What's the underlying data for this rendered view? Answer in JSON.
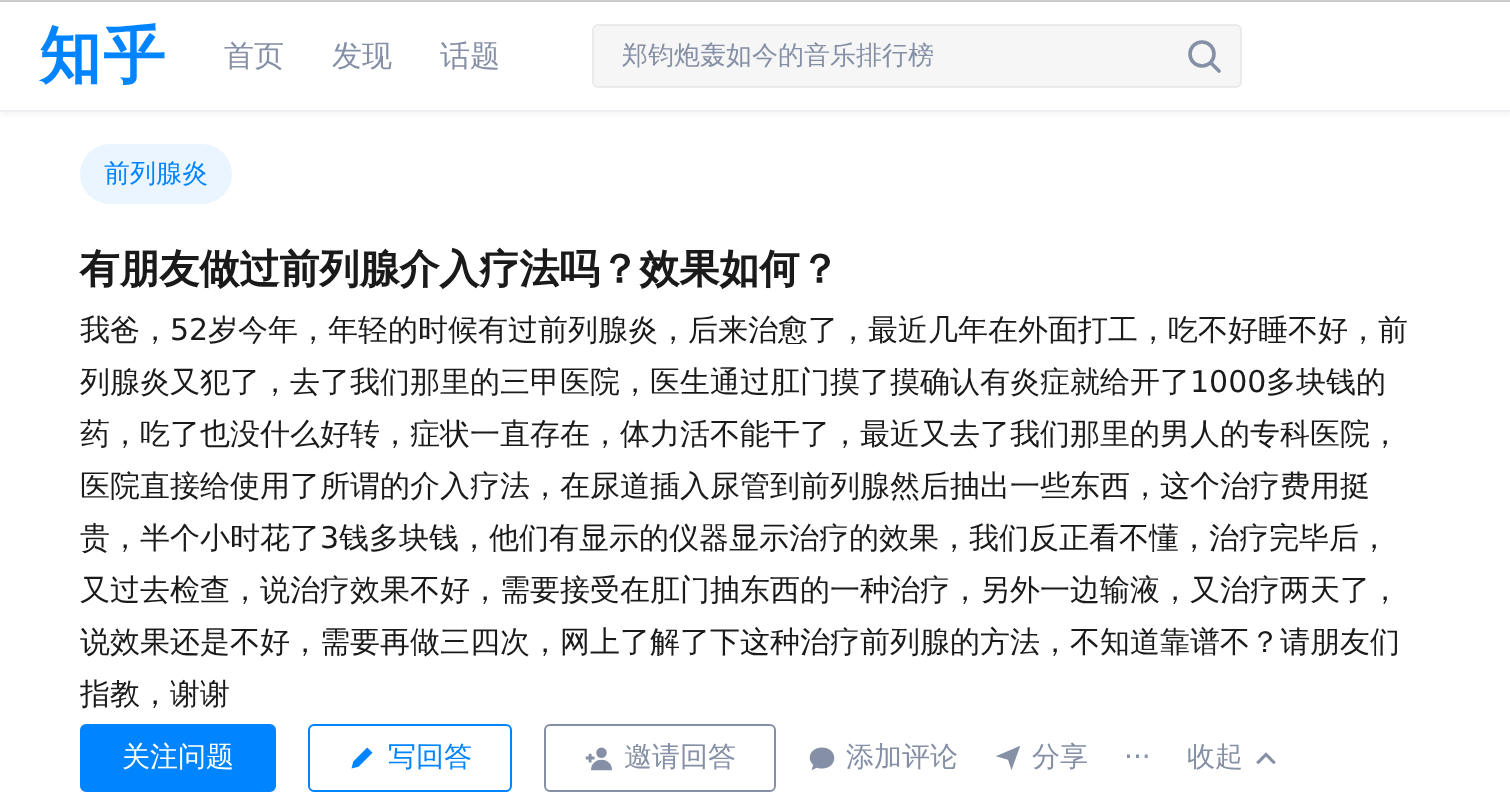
{
  "header": {
    "logo": "知乎",
    "nav": [
      {
        "label": "首页",
        "selected": false
      },
      {
        "label": "发现",
        "selected": false
      },
      {
        "label": "话题",
        "selected": false
      }
    ],
    "search": {
      "placeholder": "郑钧炮轰如今的音乐排行榜"
    }
  },
  "question": {
    "topics": [
      "前列腺炎"
    ],
    "title": "有朋友做过前列腺介入疗法吗？效果如何？",
    "body": "我爸，52岁今年，年轻的时候有过前列腺炎，后来治愈了，最近几年在外面打工，吃不好睡不好，前列腺炎又犯了，去了我们那里的三甲医院，医生通过肛门摸了摸确认有炎症就给开了1000多块钱的药，吃了也没什么好转，症状一直存在，体力活不能干了，最近又去了我们那里的男人的专科医院，医院直接给使用了所谓的介入疗法，在尿道插入尿管到前列腺然后抽出一些东西，这个治疗费用挺贵，半个小时花了3钱多块钱，他们有显示的仪器显示治疗的效果，我们反正看不懂，治疗完毕后，又过去检查，说治疗效果不好，需要接受在肛门抽东西的一种治疗，另外一边输液，又治疗两天了，说效果还是不好，需要再做三四次，网上了解了下这种治疗前列腺的方法，不知道靠谱不？请朋友们指教，谢谢"
  },
  "actions": [
    {
      "kind": "follow",
      "label": "关注问题"
    },
    {
      "kind": "write",
      "label": "写回答"
    },
    {
      "kind": "invite",
      "label": "邀请回答"
    },
    {
      "kind": "comment",
      "label": "添加评论"
    },
    {
      "kind": "share",
      "label": "分享"
    },
    {
      "kind": "more",
      "label": "···"
    },
    {
      "kind": "collapse",
      "label": "收起"
    }
  ]
}
